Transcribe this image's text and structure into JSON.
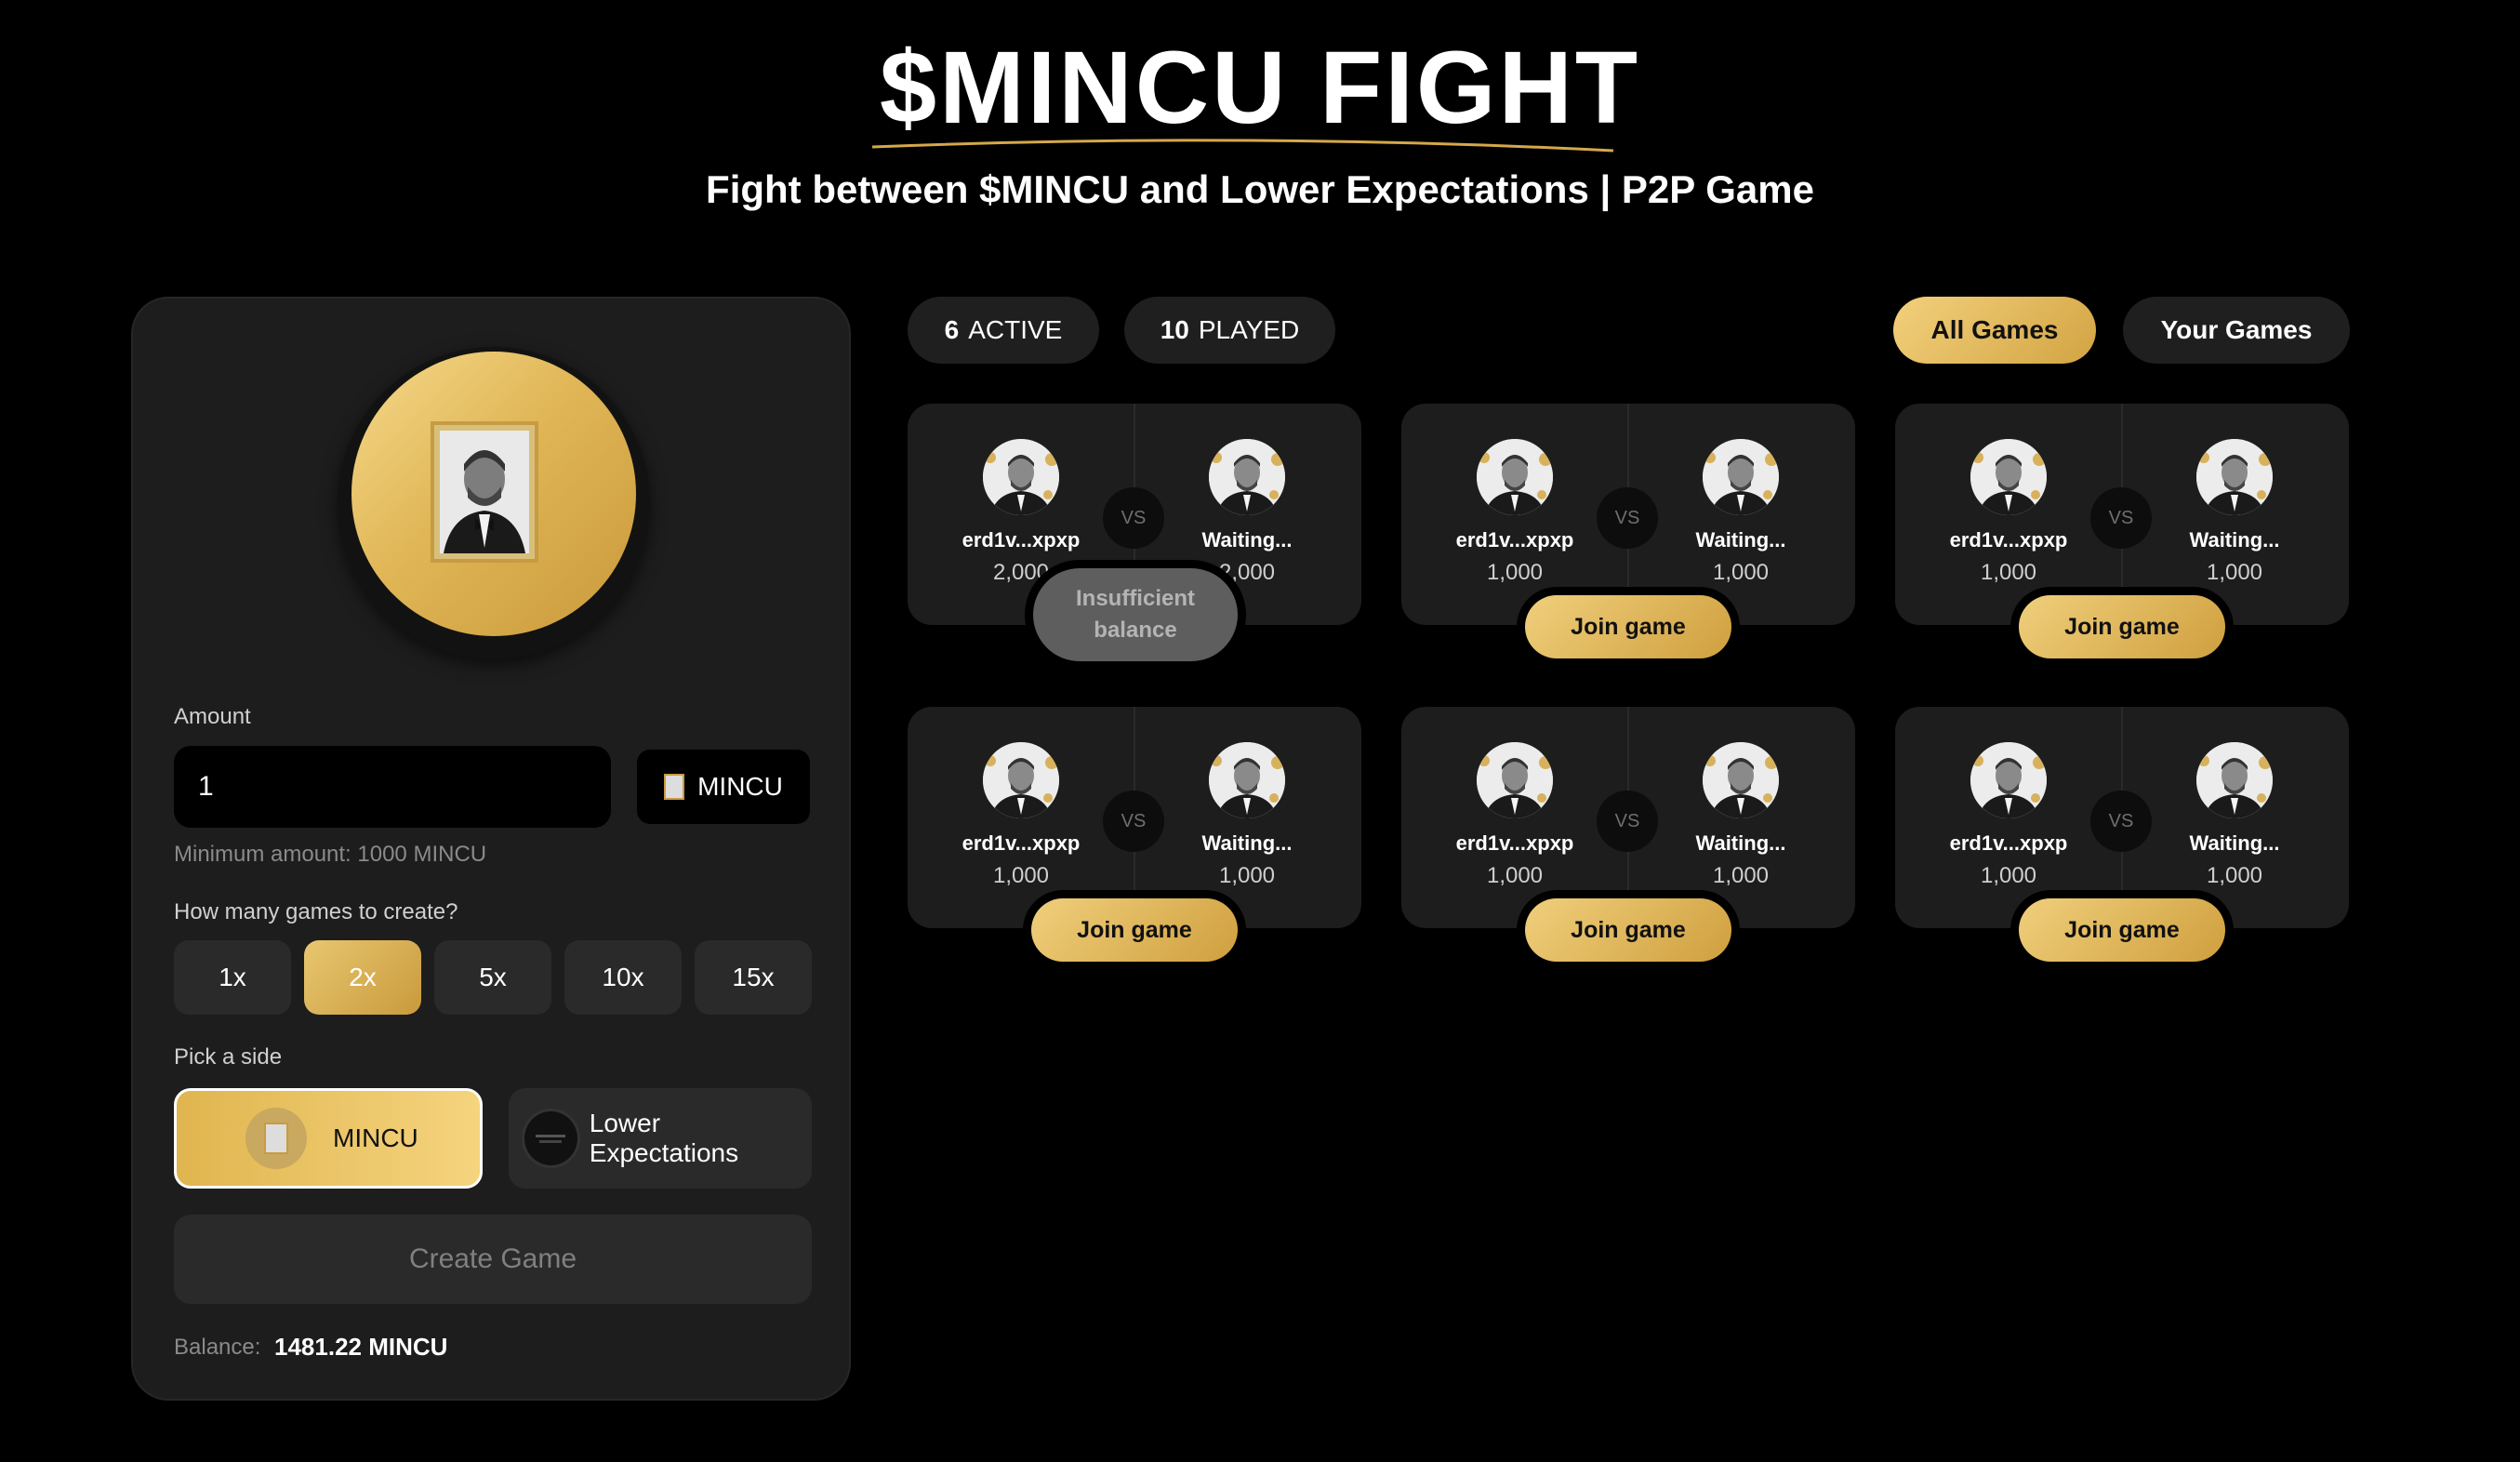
{
  "header": {
    "title": "$MINCU FIGHT",
    "subtitle": "Fight between $MINCU and Lower Expectations | P2P Game",
    "accent_color": "#d4a84a"
  },
  "create_panel": {
    "amount_label": "Amount",
    "amount_value": "1",
    "token_label": "MINCU",
    "min_amount_text": "Minimum amount: 1000 MINCU",
    "games_question": "How many games to create?",
    "multipliers": [
      "1x",
      "2x",
      "5x",
      "10x",
      "15x"
    ],
    "selected_multiplier": "2x",
    "pick_side_label": "Pick a side",
    "sides": [
      "MINCU",
      "Lower Expectations"
    ],
    "selected_side": "MINCU",
    "create_button": "Create Game",
    "balance_label": "Balance:",
    "balance_value": "1481.22 MINCU"
  },
  "stats": {
    "active_count": "6",
    "active_label": "ACTIVE",
    "played_count": "10",
    "played_label": "PLAYED"
  },
  "filters": {
    "all_games": "All Games",
    "your_games": "Your Games",
    "selected": "All Games"
  },
  "games": [
    {
      "player1": "erd1v...xpxp",
      "player2": "Waiting...",
      "amount1": "2,000",
      "amount2": "2,000",
      "vs": "VS",
      "action": "Insufficient balance",
      "action_line1": "Insufficient",
      "action_line2": "balance"
    },
    {
      "player1": "erd1v...xpxp",
      "player2": "Waiting...",
      "amount1": "1,000",
      "amount2": "1,000",
      "vs": "VS",
      "action": "Join game"
    },
    {
      "player1": "erd1v...xpxp",
      "player2": "Waiting...",
      "amount1": "1,000",
      "amount2": "1,000",
      "vs": "VS",
      "action": "Join game"
    },
    {
      "player1": "erd1v...xpxp",
      "player2": "Waiting...",
      "amount1": "1,000",
      "amount2": "1,000",
      "vs": "VS",
      "action": "Join game"
    },
    {
      "player1": "erd1v...xpxp",
      "player2": "Waiting...",
      "amount1": "1,000",
      "amount2": "1,000",
      "vs": "VS",
      "action": "Join game"
    },
    {
      "player1": "erd1v...xpxp",
      "player2": "Waiting...",
      "amount1": "1,000",
      "amount2": "1,000",
      "vs": "VS",
      "action": "Join game"
    }
  ]
}
